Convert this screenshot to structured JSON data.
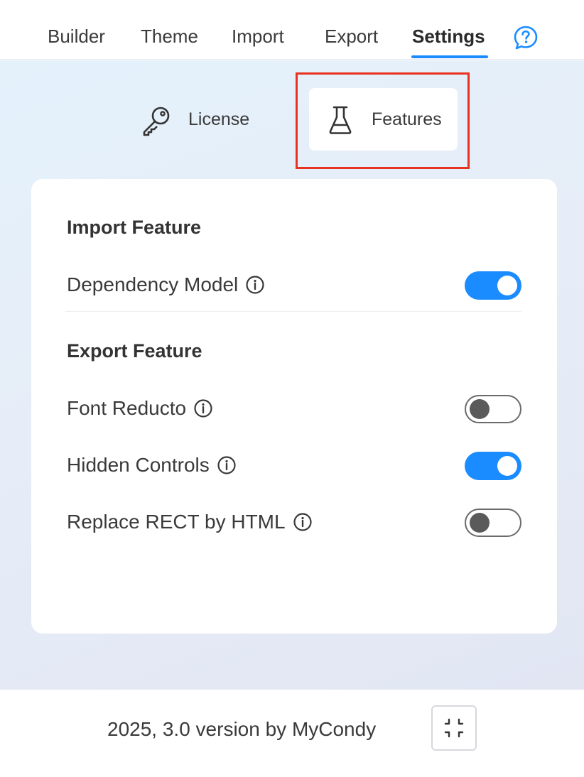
{
  "nav": {
    "tabs": [
      {
        "label": "Builder"
      },
      {
        "label": "Theme"
      },
      {
        "label": "Import"
      },
      {
        "label": "Export"
      },
      {
        "label": "Settings"
      }
    ],
    "active_tab": "Settings",
    "help_icon": "question-bubble-icon",
    "accent_color": "#1a8cff"
  },
  "subtabs": {
    "license": {
      "label": "License",
      "icon": "key-icon"
    },
    "features": {
      "label": "Features",
      "icon": "flask-icon",
      "selected": true
    },
    "highlight_color": "#e8321f"
  },
  "import_section": {
    "title": "Import Feature",
    "items": [
      {
        "label": "Dependency Model",
        "enabled": true
      }
    ]
  },
  "export_section": {
    "title": "Export Feature",
    "items": [
      {
        "label": "Font Reducto",
        "enabled": false
      },
      {
        "label": "Hidden Controls",
        "enabled": true
      },
      {
        "label": "Replace RECT by HTML",
        "enabled": false
      }
    ]
  },
  "footer": {
    "text": "2025, 3.0 version by MyCondy",
    "collapse_icon": "collapse-icon"
  }
}
